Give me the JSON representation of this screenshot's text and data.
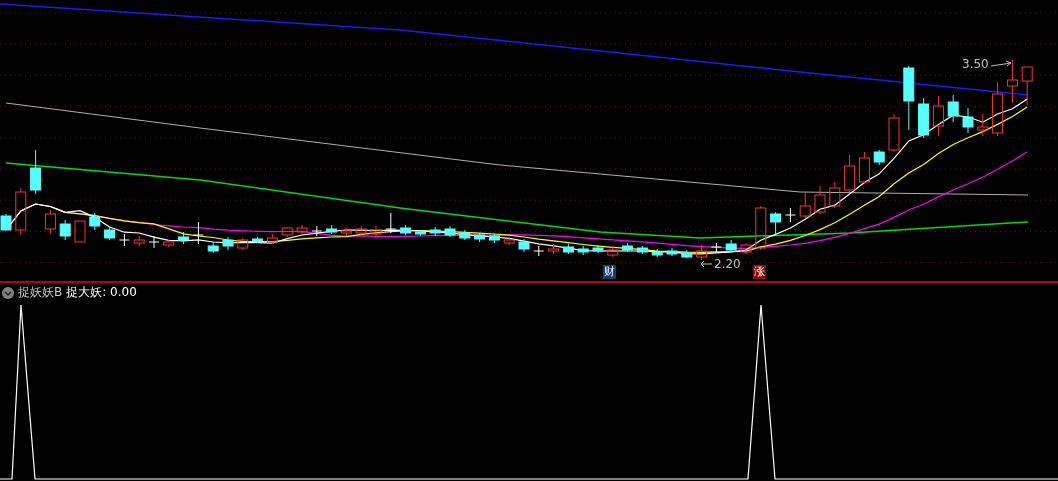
{
  "price_chart": {
    "annotations": [
      {
        "kind": "high",
        "text": "3.50"
      },
      {
        "kind": "low",
        "text": "2.20"
      }
    ],
    "markers": [
      {
        "text": "财",
        "color": "#0f3f75"
      },
      {
        "text": "涨",
        "color": "#8c0a0a"
      }
    ]
  },
  "indicator": {
    "name": "捉妖妖B",
    "reading": "捉大妖: 0.00"
  }
}
